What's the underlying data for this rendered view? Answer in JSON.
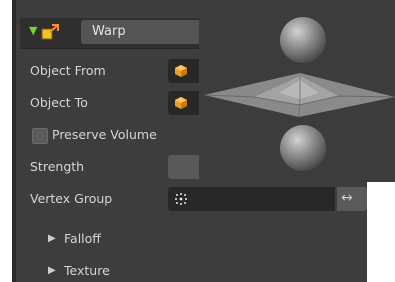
{
  "modifier": {
    "enabled_icon": "checkmark-triangle-icon",
    "type_icon": "warp-modifier-icon",
    "name": "Warp"
  },
  "fields": {
    "object_from_label": "Object From",
    "object_to_label": "Object To",
    "object_icon": "object-cube-icon",
    "preserve_volume_label": "Preserve Volume",
    "preserve_volume_checked": false,
    "strength_label": "Strength",
    "vertex_group_label": "Vertex Group",
    "vertex_group_icon": "vertex-group-icon",
    "vertex_group_swap": "↔",
    "swap_icon": "invert-arrows-icon"
  },
  "subpanels": {
    "falloff_label": "Falloff",
    "texture_label": "Texture",
    "expand_icon": "triangle-right-icon"
  },
  "colors": {
    "panel_bg": "#3d3d3d",
    "header_bg": "#2f2f2f",
    "field_dark": "#282828",
    "field_mid": "#595959",
    "accent_orange": "#f0a020",
    "enabled_green": "#6fd62c",
    "text": "#d6d6d6"
  }
}
